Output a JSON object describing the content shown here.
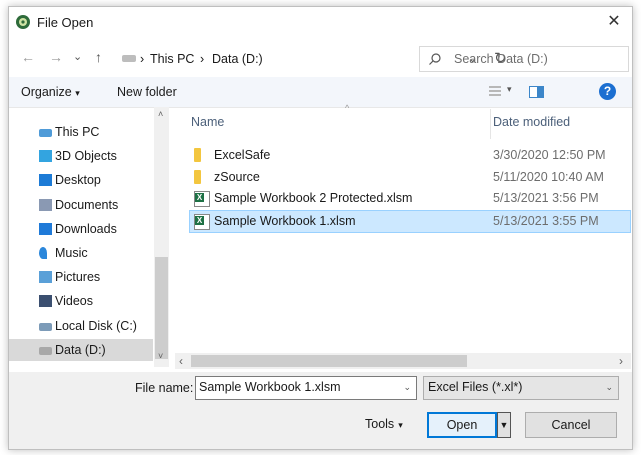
{
  "window": {
    "title": "File Open",
    "close_symbol": "✕"
  },
  "address": {
    "back": "←",
    "forward": "→",
    "recent": "⌄",
    "up": "↑",
    "path": [
      "This PC",
      "Data (D:)"
    ],
    "separator": "›",
    "dropdown": "⌄",
    "refresh": "↻"
  },
  "search": {
    "placeholder": "Search Data (D:)"
  },
  "toolbar": {
    "organize": "Organize",
    "organize_caret": "▾",
    "new_folder": "New folder",
    "view_caret": "▾",
    "help": "?"
  },
  "nav": {
    "items": [
      {
        "label": "This PC",
        "icon": "pc-icon",
        "color": "#4f9bd8"
      },
      {
        "label": "3D Objects",
        "icon": "cube-icon",
        "color": "#33a4e0"
      },
      {
        "label": "Desktop",
        "icon": "desktop-icon",
        "color": "#1d7bd6"
      },
      {
        "label": "Documents",
        "icon": "document-icon",
        "color": "#8a99b3"
      },
      {
        "label": "Downloads",
        "icon": "download-icon",
        "color": "#1f7ad8"
      },
      {
        "label": "Music",
        "icon": "music-icon",
        "color": "#2b87db"
      },
      {
        "label": "Pictures",
        "icon": "pictures-icon",
        "color": "#5aa0d8"
      },
      {
        "label": "Videos",
        "icon": "videos-icon",
        "color": "#3b4f70"
      },
      {
        "label": "Local Disk (C:)",
        "icon": "drive-c-icon",
        "color": "#7c9bb8"
      },
      {
        "label": "Data (D:)",
        "icon": "drive-d-icon",
        "color": "#a8a8a8"
      }
    ],
    "selected_index": 9
  },
  "files": {
    "columns": {
      "name": "Name",
      "date": "Date modified",
      "sort_caret": "^"
    },
    "rows": [
      {
        "name": "ExcelSafe",
        "date": "3/30/2020 12:50 PM",
        "type": "folder"
      },
      {
        "name": "zSource",
        "date": "5/11/2020 10:40 AM",
        "type": "folder"
      },
      {
        "name": "Sample Workbook 2 Protected.xlsm",
        "date": "5/13/2021 3:56 PM",
        "type": "excel"
      },
      {
        "name": "Sample Workbook 1.xlsm",
        "date": "5/13/2021 3:55 PM",
        "type": "excel"
      }
    ],
    "selected_index": 3,
    "excel_glyph": "X"
  },
  "scroll": {
    "up": "˄",
    "down": "˅",
    "left": "‹",
    "right": "›"
  },
  "bottom": {
    "filename_label": "File name:",
    "filename_value": "Sample Workbook 1.xlsm",
    "filetype_value": "Excel Files (*.xl*)",
    "dropdown": "⌄",
    "tools_label": "Tools",
    "tools_caret": "▾",
    "open_label": "Open",
    "open_split": "▼",
    "cancel_label": "Cancel"
  }
}
